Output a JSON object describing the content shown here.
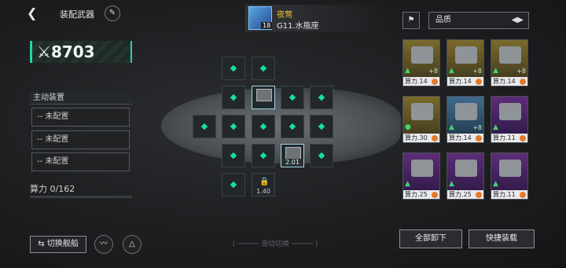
{
  "header": {
    "title": "装配武器",
    "back_icon": "chevron-left-icon",
    "edit_icon": "pen-icon"
  },
  "pilot": {
    "name": "夜莺",
    "team": "G11.水瓶座",
    "level": "18"
  },
  "power": {
    "value": "8703",
    "icon": "crossed-swords-icon"
  },
  "main_equipment": {
    "title": "主动装置",
    "slots": [
      "-- 未配置",
      "-- 未配置",
      "-- 未配置"
    ]
  },
  "stat": {
    "label": "算力",
    "current": "0",
    "max": "/162"
  },
  "left_controls": {
    "switch_ship": "⇆ 切换舰船"
  },
  "swipe_hint": "滑动切换",
  "grid": {
    "filled_value": "2.01",
    "locked_value": "1.40"
  },
  "right_panel": {
    "quality_label": "品质",
    "cards": [
      {
        "rarity": "gold",
        "power": "算力.14",
        "plus": "+8"
      },
      {
        "rarity": "gold",
        "power": "算力.14",
        "plus": "+8"
      },
      {
        "rarity": "gold",
        "power": "算力.14",
        "plus": "+8"
      },
      {
        "rarity": "gold",
        "power": "算力.30",
        "plus": ""
      },
      {
        "rarity": "blue",
        "power": "算力.14",
        "plus": "+8"
      },
      {
        "rarity": "purple",
        "power": "算力.11",
        "plus": ""
      },
      {
        "rarity": "purple",
        "power": "算力.25",
        "plus": ""
      },
      {
        "rarity": "purple",
        "power": "算力.25",
        "plus": ""
      },
      {
        "rarity": "purple",
        "power": "算力.11",
        "plus": ""
      }
    ],
    "buttons": {
      "unequip_all": "全部卸下",
      "quick_equip": "快捷装载"
    }
  }
}
